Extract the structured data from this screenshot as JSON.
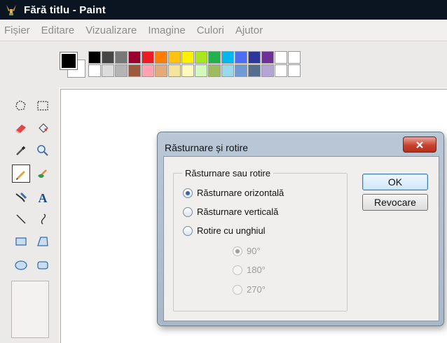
{
  "window": {
    "title": "Fără titlu - Paint"
  },
  "menu": [
    "Fișier",
    "Editare",
    "Vizualizare",
    "Imagine",
    "Culori",
    "Ajutor"
  ],
  "palette": {
    "foreground": "#000000",
    "background": "#ffffff",
    "row1": [
      "#000000",
      "#464646",
      "#787878",
      "#990030",
      "#ed1c24",
      "#ff7e00",
      "#ffc20e",
      "#fff200",
      "#a8e61d",
      "#22b14c",
      "#00b7ef",
      "#4d6df3",
      "#2f3699",
      "#6f3198",
      "#ffffff",
      "#ffffff"
    ],
    "row2": [
      "#ffffff",
      "#dcdcdc",
      "#b4b4b4",
      "#9c5a3c",
      "#ffa3b1",
      "#e5aa7a",
      "#f5e49c",
      "#fff9bd",
      "#d3f9bc",
      "#9dbb61",
      "#99d9ea",
      "#709ad1",
      "#546d8e",
      "#b5a5d5",
      "#ffffff",
      "#ffffff"
    ]
  },
  "tools": [
    {
      "name": "free-select-icon",
      "selected": false
    },
    {
      "name": "rect-select-icon",
      "selected": false
    },
    {
      "name": "eraser-icon",
      "selected": false
    },
    {
      "name": "fill-bucket-icon",
      "selected": false
    },
    {
      "name": "color-picker-icon",
      "selected": false
    },
    {
      "name": "magnifier-icon",
      "selected": false
    },
    {
      "name": "pencil-icon",
      "selected": true
    },
    {
      "name": "brush-icon",
      "selected": false
    },
    {
      "name": "airbrush-icon",
      "selected": false
    },
    {
      "name": "text-icon",
      "selected": false
    },
    {
      "name": "line-icon",
      "selected": false
    },
    {
      "name": "curve-icon",
      "selected": false
    },
    {
      "name": "rectangle-icon",
      "selected": false
    },
    {
      "name": "polygon-icon",
      "selected": false
    },
    {
      "name": "ellipse-icon",
      "selected": false
    },
    {
      "name": "rounded-rect-icon",
      "selected": false
    }
  ],
  "dialog": {
    "title": "Răsturnare și rotire",
    "close_icon": "close-icon",
    "group_label": "Răsturnare sau rotire",
    "options": [
      {
        "label": "Răsturnare orizontală",
        "checked": true
      },
      {
        "label": "Răsturnare verticală",
        "checked": false
      },
      {
        "label": "Rotire cu unghiul",
        "checked": false
      }
    ],
    "angles": [
      {
        "label": "90°",
        "checked": true
      },
      {
        "label": "180°",
        "checked": false
      },
      {
        "label": "270°",
        "checked": false
      }
    ],
    "ok_label": "OK",
    "cancel_label": "Revocare"
  }
}
